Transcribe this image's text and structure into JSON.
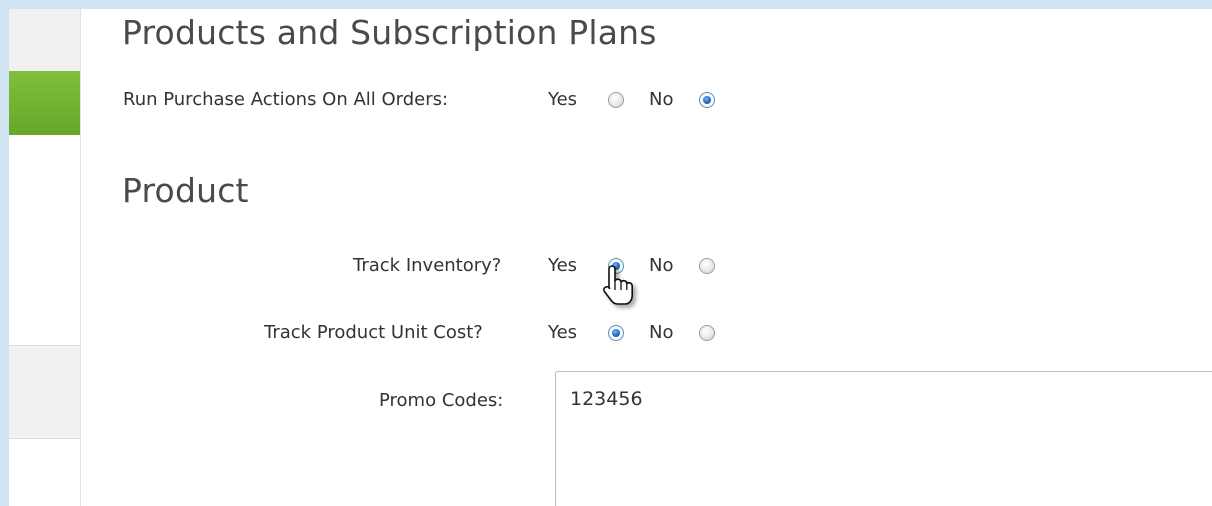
{
  "sections": {
    "products_title": "Products and Subscription Plans",
    "product_title": "Product"
  },
  "fields": {
    "run_purchase": {
      "label": "Run Purchase Actions On All Orders:",
      "yes": "Yes",
      "no": "No",
      "selected": "No"
    },
    "track_inventory": {
      "label": "Track Inventory?",
      "yes": "Yes",
      "no": "No",
      "selected": "Yes"
    },
    "track_unit_cost": {
      "label": "Track Product Unit Cost?",
      "yes": "Yes",
      "no": "No",
      "selected": "Yes"
    },
    "promo_codes": {
      "label": "Promo Codes:",
      "value": "123456"
    }
  },
  "icons": {
    "cursor": "hand-pointer-icon"
  },
  "colors": {
    "sidebar_active": "#6fb131",
    "background": "#cfe3f0",
    "radio_checked": "#1f63b8"
  }
}
